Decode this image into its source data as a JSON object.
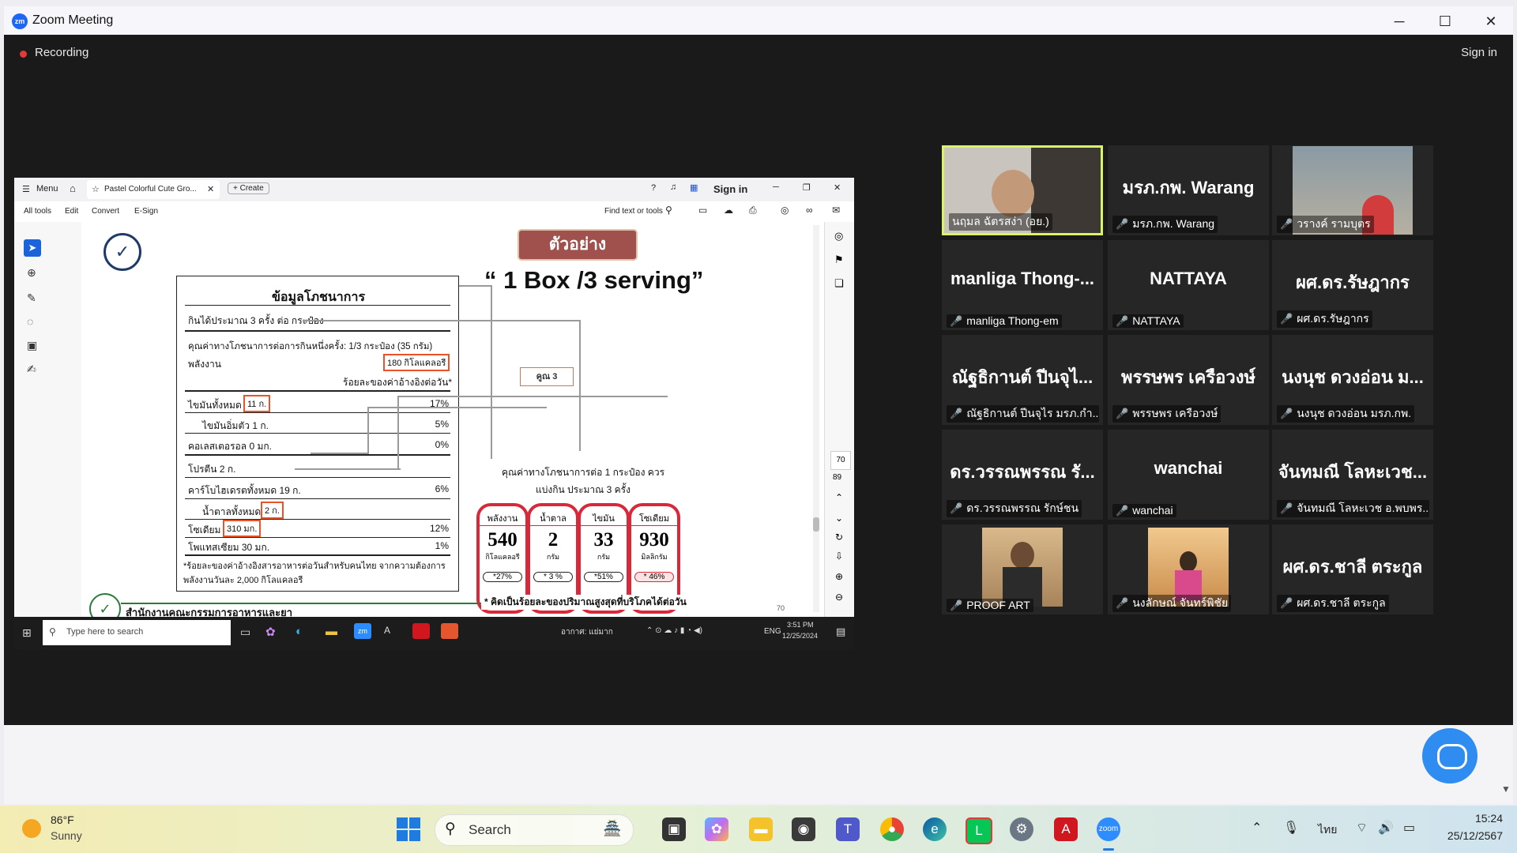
{
  "zoom_window": {
    "title": "Zoom Meeting",
    "logo_text": "zm",
    "recording_label": "Recording",
    "sign_in": "Sign in",
    "minimize_glyph": "─",
    "maximize_glyph": "☐",
    "close_glyph": "✕"
  },
  "acrobat": {
    "menu": "Menu",
    "tab_title": "Pastel Colorful Cute Gro...",
    "create": "+ Create",
    "sign_in": "Sign in",
    "toolbar": {
      "all_tools": "All tools",
      "edit": "Edit",
      "convert": "Convert",
      "esign": "E-Sign",
      "find": "Find text or tools"
    },
    "page_number": "70",
    "page_total": "89",
    "footer_page": "70"
  },
  "document": {
    "sample_badge": "ตัวอย่าง",
    "serving_title": "“ 1 Box /3 serving”",
    "nutrition": {
      "title": "ข้อมูลโภชนาการ",
      "servings": "กินได้ประมาณ 3 ครั้ง ต่อ กระป๋อง",
      "per_serving": "คุณค่าทางโภชนาการต่อการกินหนึ่งครั้ง: 1/3 กระป๋อง (35 กรัม)",
      "energy_label": "พลังงาน",
      "energy_value": "180 กิโลแคลอรี",
      "percent_header": "ร้อยละของค่าอ้างอิงต่อวัน*",
      "fat_label": "ไขมันทั้งหมด",
      "fat_value": "11 ก.",
      "fat_pct": "17%",
      "satfat": "ไขมันอิ่มตัว 1 ก.",
      "satfat_pct": "5%",
      "chol": "คอเลสเตอรอล 0 มก.",
      "chol_pct": "0%",
      "protein": "โปรตีน 2 ก.",
      "carb": "คาร์โบไฮเดรตทั้งหมด 19 ก.",
      "carb_pct": "6%",
      "sugar_label": "น้ำตาลทั้งหมด",
      "sugar_value": "2 ก.",
      "sodium_label": "โซเดียม",
      "sodium_value": "310 มก.",
      "sodium_pct": "12%",
      "potassium": "โพแทสเซียม 30 มก.",
      "potassium_pct": "1%",
      "footnote": "*ร้อยละของค่าอ้างอิงสารอาหารต่อวันสำหรับคนไทย จากความต้องการพลังงานวันละ 2,000 กิโลแคลอรี"
    },
    "multiply_label": "คูณ 3",
    "per_can_note": "คุณค่าทางโภชนาการต่อ 1 กระป๋อง ควรแบ่งกิน ประมาณ 3 ครั้ง",
    "gda": [
      {
        "label": "พลังงาน",
        "value": "540",
        "unit": "กิโลแคลอรี",
        "pct": "*27%"
      },
      {
        "label": "น้ำตาล",
        "value": "2",
        "unit": "กรัม",
        "pct": "* 3 %"
      },
      {
        "label": "ไขมัน",
        "value": "33",
        "unit": "กรัม",
        "pct": "*51%"
      },
      {
        "label": "โซเดียม",
        "value": "930",
        "unit": "มิลลิกรัม",
        "pct": "* 46%"
      }
    ],
    "bottom_org": "สำนักงานคณะกรรมการอาหารและยา",
    "bottom_note": "* คิดเป็นร้อยละของปริมาณสูงสุดที่บริโภคได้ต่อวัน"
  },
  "inner_taskbar": {
    "search_placeholder": "Type here to search",
    "weather": "อากาศ: แย่มาก",
    "lang": "ENG",
    "time": "3:51 PM",
    "date": "12/25/2024"
  },
  "participants": [
    {
      "display": "",
      "label": "นฤมล ฉัตรสง่า (อย.)",
      "video": true,
      "active": true
    },
    {
      "display": "มรภ.กพ. Warang",
      "label": "มรภ.กพ. Warang",
      "video": false
    },
    {
      "display": "",
      "label": "วรางค์ รามบุตร",
      "video": true
    },
    {
      "display": "manliga Thong-...",
      "label": "manliga Thong-em",
      "video": false
    },
    {
      "display": "NATTAYA",
      "label": "NATTAYA",
      "video": false
    },
    {
      "display": "ผศ.ดร.รัษฎากร",
      "label": "ผศ.ดร.รัษฎากร",
      "video": false
    },
    {
      "display": "ณัฐธิกานต์ ปีนจุไ...",
      "label": "ณัฐธิกานต์ ปีนจุไร มรภ.กำ...",
      "video": false
    },
    {
      "display": "พรรษพร เครือวงษ์",
      "label": "พรรษพร เครือวงษ์",
      "video": false
    },
    {
      "display": "นงนุช ดวงอ่อน ม...",
      "label": "นงนุช ดวงอ่อน มรภ.กพ.",
      "video": false
    },
    {
      "display": "ดร.วรรณพรรณ รั...",
      "label": "ดร.วรรณพรรณ รักษ์ชน",
      "video": false
    },
    {
      "display": "wanchai",
      "label": "wanchai",
      "video": false
    },
    {
      "display": "จันทมณี โลหะเวช...",
      "label": "จันทมณี โลหะเวช อ.พบพร...",
      "video": false
    },
    {
      "display": "",
      "label": "PROOF ART",
      "video": true
    },
    {
      "display": "",
      "label": "นงลักษณ์ จันทร์พิชัย",
      "video": true
    },
    {
      "display": "ผศ.ดร.ชาลี ตระกูล",
      "label": "ผศ.ดร.ชาลี ตระกูล",
      "video": false
    }
  ],
  "taskbar": {
    "weather_temp": "86°F",
    "weather_desc": "Sunny",
    "search_label": "Search",
    "lang": "ไทย",
    "time": "15:24",
    "date": "25/12/2567"
  },
  "colors": {
    "zoom_blue": "#1e66f5",
    "accent_red": "#d8283a",
    "box_orange": "#e8532a",
    "active_border": "#d9f36b"
  }
}
